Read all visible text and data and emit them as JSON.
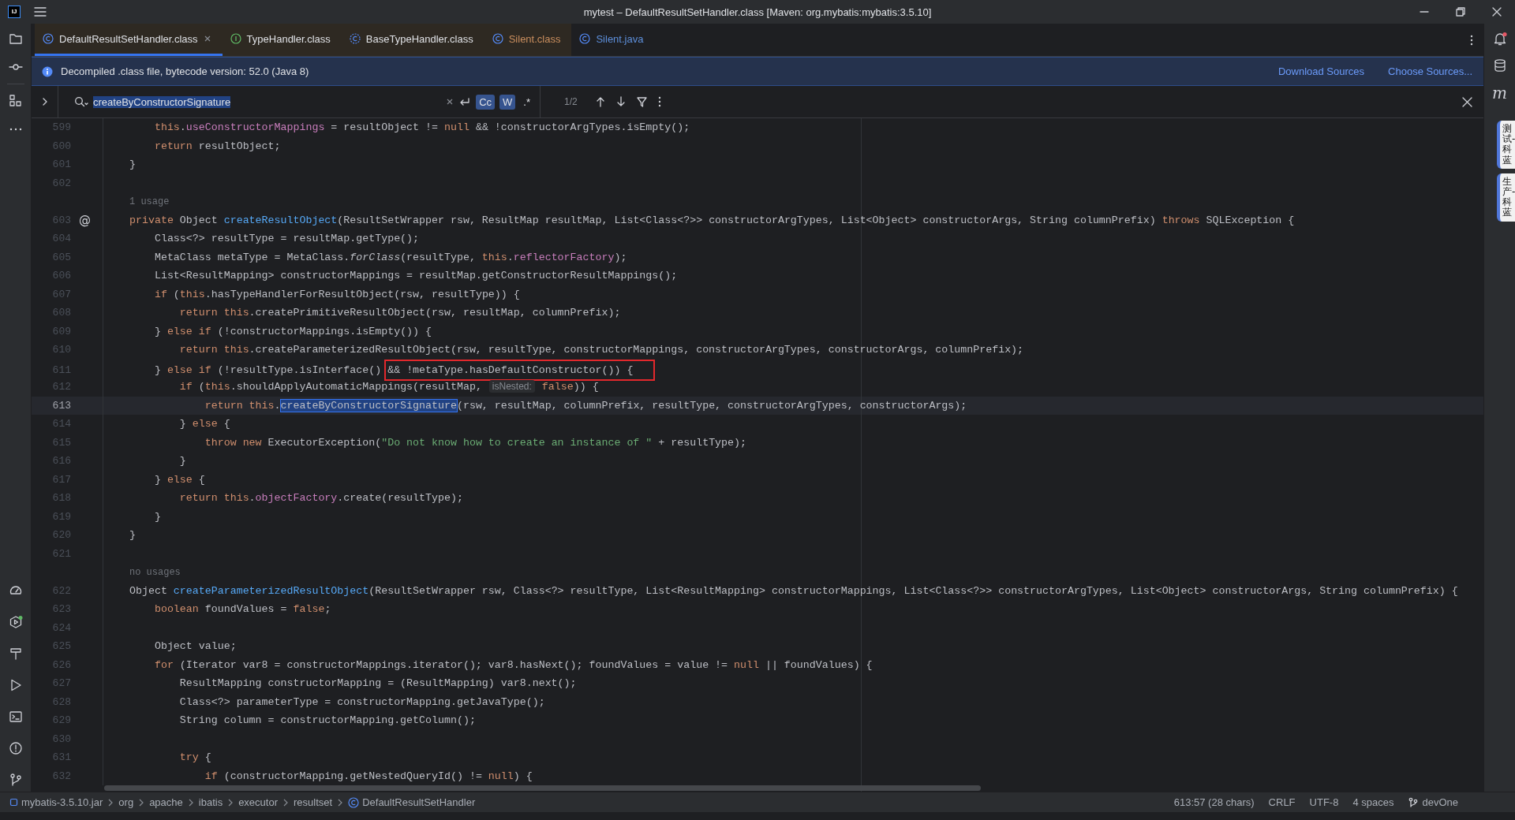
{
  "window": {
    "logo": "IJ",
    "title": "mytest – DefaultResultSetHandler.class [Maven: org.mybatis:mybatis:3.5.10]"
  },
  "right_toolbar": {
    "maven_label": "m"
  },
  "tabs": [
    {
      "label": "DefaultResultSetHandler.class",
      "kind": "class",
      "library": true,
      "selected": true,
      "color": "#dfe1e5"
    },
    {
      "label": "TypeHandler.class",
      "kind": "interface",
      "library": true,
      "selected": false,
      "color": "#dfe1e5"
    },
    {
      "label": "BaseTypeHandler.class",
      "kind": "abstract",
      "library": true,
      "selected": false,
      "color": "#dfe1e5"
    },
    {
      "label": "Silent.class",
      "kind": "class",
      "library": true,
      "selected": false,
      "color": "#c98e5e"
    },
    {
      "label": "Silent.java",
      "kind": "class",
      "library": false,
      "selected": false,
      "color": "#5d8fdb"
    }
  ],
  "banner": {
    "message": "Decompiled .class file, bytecode version: 52.0 (Java 8)",
    "links": [
      "Download Sources",
      "Choose Sources..."
    ]
  },
  "search": {
    "value": "createByConstructorSignature",
    "options": [
      {
        "label": "Cc",
        "on": true
      },
      {
        "label": "W",
        "on": true
      },
      {
        "label": ".*",
        "on": false
      }
    ],
    "count": "1/2"
  },
  "editor": {
    "rows": [
      {
        "kind": "code",
        "number": "599",
        "current": false,
        "segments": [
          {
            "kind": "keyword",
            "text": "    this"
          },
          {
            "kind": "plain",
            "text": "."
          },
          {
            "kind": "field",
            "text": "useConstructorMappings"
          },
          {
            "kind": "plain",
            "text": " = resultObject != "
          },
          {
            "kind": "keyword",
            "text": "null"
          },
          {
            "kind": "plain",
            "text": " && !constructorArgTypes.isEmpty();"
          }
        ]
      },
      {
        "kind": "code",
        "number": "600",
        "current": false,
        "segments": [
          {
            "kind": "keyword",
            "text": "    return"
          },
          {
            "kind": "plain",
            "text": " resultObject;"
          }
        ]
      },
      {
        "kind": "code",
        "number": "601",
        "current": false,
        "segments": [
          {
            "kind": "plain",
            "text": "}"
          }
        ]
      },
      {
        "kind": "code",
        "number": "602",
        "current": false
      },
      {
        "kind": "hint",
        "text": "1 usage"
      },
      {
        "kind": "code",
        "number": "603",
        "current": false,
        "gutter_mark": "@",
        "segments": [
          {
            "kind": "keyword",
            "text": "private"
          },
          {
            "kind": "plain",
            "text": " Object "
          },
          {
            "kind": "method",
            "text": "createResultObject"
          },
          {
            "kind": "plain",
            "text": "(ResultSetWrapper rsw, ResultMap resultMap, List<Class<?>> constructorArgTypes, List<Object> constructorArgs, String columnPrefix) "
          },
          {
            "kind": "keyword",
            "text": "throws"
          },
          {
            "kind": "plain",
            "text": " SQLException {"
          }
        ]
      },
      {
        "kind": "code",
        "number": "604",
        "current": false,
        "segments": [
          {
            "kind": "plain",
            "text": "    Class<?> resultType = resultMap.getType();"
          }
        ]
      },
      {
        "kind": "code",
        "number": "605",
        "current": false,
        "segments": [
          {
            "kind": "plain",
            "text": "    MetaClass metaType = MetaClass."
          },
          {
            "kind": "static",
            "text": "forClass"
          },
          {
            "kind": "plain",
            "text": "(resultType, "
          },
          {
            "kind": "keyword",
            "text": "this"
          },
          {
            "kind": "plain",
            "text": "."
          },
          {
            "kind": "field",
            "text": "reflectorFactory"
          },
          {
            "kind": "plain",
            "text": ");"
          }
        ]
      },
      {
        "kind": "code",
        "number": "606",
        "current": false,
        "segments": [
          {
            "kind": "plain",
            "text": "    List<ResultMapping> constructorMappings = resultMap.getConstructorResultMappings();"
          }
        ]
      },
      {
        "kind": "code",
        "number": "607",
        "current": false,
        "segments": [
          {
            "kind": "keyword",
            "text": "    if"
          },
          {
            "kind": "plain",
            "text": " ("
          },
          {
            "kind": "keyword",
            "text": "this"
          },
          {
            "kind": "plain",
            "text": ".hasTypeHandlerForResultObject(rsw, resultType)) {"
          }
        ]
      },
      {
        "kind": "code",
        "number": "608",
        "current": false,
        "segments": [
          {
            "kind": "keyword",
            "text": "        return this"
          },
          {
            "kind": "plain",
            "text": ".createPrimitiveResultObject(rsw, resultMap, columnPrefix);"
          }
        ]
      },
      {
        "kind": "code",
        "number": "609",
        "current": false,
        "segments": [
          {
            "kind": "plain",
            "text": "    } "
          },
          {
            "kind": "keyword",
            "text": "else if"
          },
          {
            "kind": "plain",
            "text": " (!constructorMappings.isEmpty()) {"
          }
        ]
      },
      {
        "kind": "code",
        "number": "610",
        "current": false,
        "segments": [
          {
            "kind": "keyword",
            "text": "        return this"
          },
          {
            "kind": "plain",
            "text": ".createParameterizedResultObject(rsw, resultType, constructorMappings, constructorArgTypes, constructorArgs, columnPrefix);"
          }
        ]
      },
      {
        "kind": "code",
        "number": "611",
        "current": false,
        "segments": [
          {
            "kind": "plain",
            "text": "    } "
          },
          {
            "kind": "keyword",
            "text": "else if"
          },
          {
            "kind": "plain",
            "text": " (!resultType.isInterface() "
          },
          {
            "kind": "boxed",
            "text": "&& !metaType.hasDefaultConstructor()) {"
          }
        ]
      },
      {
        "kind": "code",
        "number": "612",
        "current": false,
        "segments": [
          {
            "kind": "keyword",
            "text": "        if"
          },
          {
            "kind": "plain",
            "text": " ("
          },
          {
            "kind": "keyword",
            "text": "this"
          },
          {
            "kind": "plain",
            "text": ".shouldApplyAutomaticMappings(resultMap, "
          },
          {
            "kind": "hint",
            "text": "isNested:"
          },
          {
            "kind": "keyword",
            "text": " false"
          },
          {
            "kind": "plain",
            "text": ")) {"
          }
        ]
      },
      {
        "kind": "code",
        "number": "613",
        "current": true,
        "segments": [
          {
            "kind": "keyword",
            "text": "            return this"
          },
          {
            "kind": "plain",
            "text": "."
          },
          {
            "kind": "match",
            "text": "createByConstructorSignature"
          },
          {
            "kind": "plain",
            "text": "(rsw, resultMap, columnPrefix, resultType, constructorArgTypes, constructorArgs);"
          }
        ]
      },
      {
        "kind": "code",
        "number": "614",
        "current": false,
        "segments": [
          {
            "kind": "plain",
            "text": "        } "
          },
          {
            "kind": "keyword",
            "text": "else"
          },
          {
            "kind": "plain",
            "text": " {"
          }
        ]
      },
      {
        "kind": "code",
        "number": "615",
        "current": false,
        "segments": [
          {
            "kind": "keyword",
            "text": "            throw new"
          },
          {
            "kind": "plain",
            "text": " ExecutorException("
          },
          {
            "kind": "string",
            "text": "\"Do not know how to create an instance of \""
          },
          {
            "kind": "plain",
            "text": " + resultType);"
          }
        ]
      },
      {
        "kind": "code",
        "number": "616",
        "current": false,
        "segments": [
          {
            "kind": "plain",
            "text": "        }"
          }
        ]
      },
      {
        "kind": "code",
        "number": "617",
        "current": false,
        "segments": [
          {
            "kind": "plain",
            "text": "    } "
          },
          {
            "kind": "keyword",
            "text": "else"
          },
          {
            "kind": "plain",
            "text": " {"
          }
        ]
      },
      {
        "kind": "code",
        "number": "618",
        "current": false,
        "segments": [
          {
            "kind": "keyword",
            "text": "        return this"
          },
          {
            "kind": "plain",
            "text": "."
          },
          {
            "kind": "field",
            "text": "objectFactory"
          },
          {
            "kind": "plain",
            "text": ".create(resultType);"
          }
        ]
      },
      {
        "kind": "code",
        "number": "619",
        "current": false,
        "segments": [
          {
            "kind": "plain",
            "text": "    }"
          }
        ]
      },
      {
        "kind": "code",
        "number": "620",
        "current": false,
        "segments": [
          {
            "kind": "plain",
            "text": "}"
          }
        ]
      },
      {
        "kind": "code",
        "number": "621",
        "current": false
      },
      {
        "kind": "hint",
        "text": "no usages"
      },
      {
        "kind": "code",
        "number": "622",
        "current": false,
        "segments": [
          {
            "kind": "plain",
            "text": "Object "
          },
          {
            "kind": "method",
            "text": "createParameterizedResultObject"
          },
          {
            "kind": "plain",
            "text": "(ResultSetWrapper rsw, Class<?> resultType, List<ResultMapping> constructorMappings, List<Class<?>> constructorArgTypes, List<Object> constructorArgs, String columnPrefix) {"
          }
        ]
      },
      {
        "kind": "code",
        "number": "623",
        "current": false,
        "segments": [
          {
            "kind": "keyword",
            "text": "    boolean"
          },
          {
            "kind": "plain",
            "text": " foundValues = "
          },
          {
            "kind": "keyword",
            "text": "false"
          },
          {
            "kind": "plain",
            "text": ";"
          }
        ]
      },
      {
        "kind": "code",
        "number": "624",
        "current": false
      },
      {
        "kind": "code",
        "number": "625",
        "current": false,
        "segments": [
          {
            "kind": "plain",
            "text": "    Object value;"
          }
        ]
      },
      {
        "kind": "code",
        "number": "626",
        "current": false,
        "segments": [
          {
            "kind": "keyword",
            "text": "    for"
          },
          {
            "kind": "plain",
            "text": " (Iterator var8 = constructorMappings.iterator(); var8.hasNext(); foundValues = value != "
          },
          {
            "kind": "keyword",
            "text": "null"
          },
          {
            "kind": "plain",
            "text": " || foundValues) {"
          }
        ]
      },
      {
        "kind": "code",
        "number": "627",
        "current": false,
        "segments": [
          {
            "kind": "plain",
            "text": "        ResultMapping constructorMapping = (ResultMapping) var8.next();"
          }
        ]
      },
      {
        "kind": "code",
        "number": "628",
        "current": false,
        "segments": [
          {
            "kind": "plain",
            "text": "        Class<?> parameterType = constructorMapping.getJavaType();"
          }
        ]
      },
      {
        "kind": "code",
        "number": "629",
        "current": false,
        "segments": [
          {
            "kind": "plain",
            "text": "        String column = constructorMapping.getColumn();"
          }
        ]
      },
      {
        "kind": "code",
        "number": "630",
        "current": false
      },
      {
        "kind": "code",
        "number": "631",
        "current": false,
        "segments": [
          {
            "kind": "keyword",
            "text": "        try"
          },
          {
            "kind": "plain",
            "text": " {"
          }
        ]
      },
      {
        "kind": "code",
        "number": "632",
        "current": false,
        "segments": [
          {
            "kind": "keyword",
            "text": "            if"
          },
          {
            "kind": "plain",
            "text": " (constructorMapping.getNestedQueryId() != "
          },
          {
            "kind": "keyword",
            "text": "null"
          },
          {
            "kind": "plain",
            "text": ") {"
          }
        ]
      }
    ]
  },
  "breadcrumbs": [
    {
      "label": "mybatis-3.5.10.jar",
      "kind": "module"
    },
    {
      "label": "org",
      "kind": "package"
    },
    {
      "label": "apache",
      "kind": "package"
    },
    {
      "label": "ibatis",
      "kind": "package"
    },
    {
      "label": "executor",
      "kind": "package"
    },
    {
      "label": "resultset",
      "kind": "package"
    },
    {
      "label": "DefaultResultSetHandler",
      "kind": "class"
    }
  ],
  "status_bar": {
    "position": "613:57 (28 chars)",
    "line_separator": "CRLF",
    "encoding": "UTF-8",
    "indent": "4 spaces",
    "branch": "devOne"
  },
  "side_tags": [
    "测试-科蓝",
    "生产-科蓝"
  ]
}
